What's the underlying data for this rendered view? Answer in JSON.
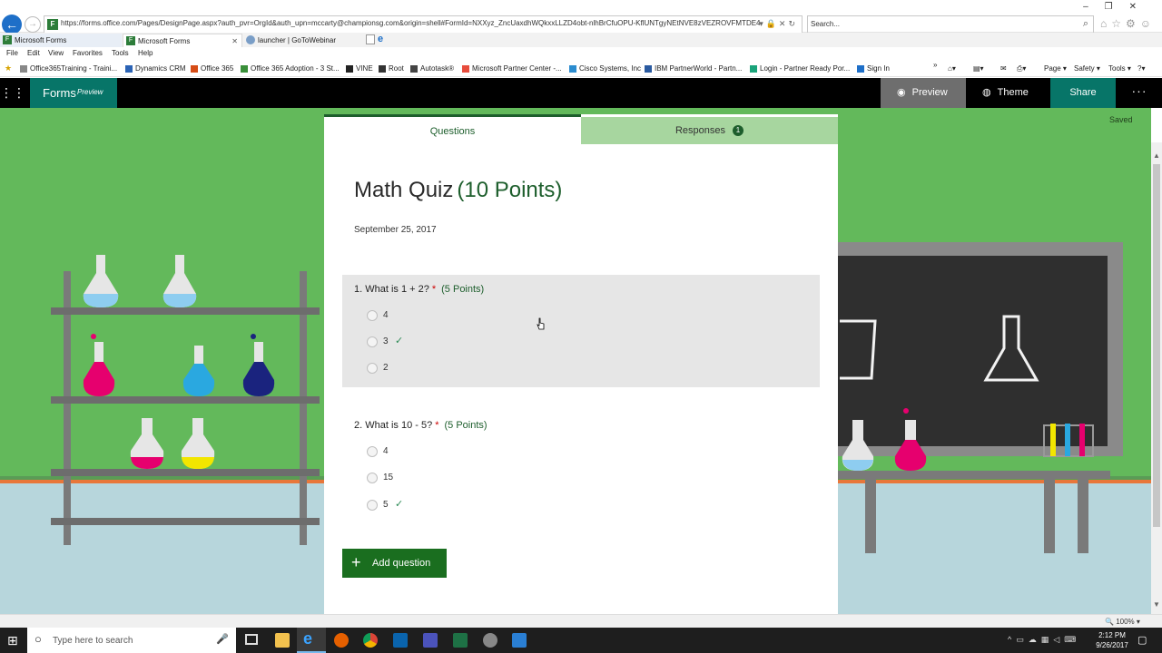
{
  "browser": {
    "url": "https://forms.office.com/Pages/DesignPage.aspx?auth_pvr=OrgId&auth_upn=mccarty@championsg.com&origin=shell#FormId=NXXyz_ZncUaxdhWQkxxLLZD4obt-nlhBrCfuOPU-KflUNTgyNEtNVE8zVEZROVFMTDE4TFBM",
    "search_placeholder": "Search...",
    "tabs": [
      {
        "label": "Microsoft Forms"
      },
      {
        "label": "Microsoft Forms"
      },
      {
        "label": "launcher | GoToWebinar"
      }
    ],
    "menu": [
      "File",
      "Edit",
      "View",
      "Favorites",
      "Tools",
      "Help"
    ],
    "favorites": [
      {
        "label": "Office365Training - Traini...",
        "color": "#c7a93a"
      },
      {
        "label": "Dynamics CRM",
        "color": "#2b63b5"
      },
      {
        "label": "Office 365",
        "color": "#d64c16"
      },
      {
        "label": "Office 365 Adoption - 3 St...",
        "color": "#3a8f3a"
      },
      {
        "label": "VINE",
        "color": "#222222"
      },
      {
        "label": "Root",
        "color": "#333333"
      },
      {
        "label": "Autotask®",
        "color": "#444444"
      },
      {
        "label": "Microsoft Partner Center -...",
        "color": "#e74c3c"
      },
      {
        "label": "Cisco Systems, Inc",
        "color": "#2b8ccf"
      },
      {
        "label": "IBM PartnerWorld - Partn...",
        "color": "#2a5aa0"
      },
      {
        "label": "Login - Partner Ready Por...",
        "color": "#1aa37a"
      },
      {
        "label": "Sign In",
        "color": "#1e6fc8"
      }
    ],
    "commands": [
      "Page ▾",
      "Safety ▾",
      "Tools ▾"
    ],
    "zoom": "100%"
  },
  "appbar": {
    "brand": "Forms",
    "brand_suffix": "Preview",
    "preview_label": "Preview",
    "theme_label": "Theme",
    "share_label": "Share",
    "more_label": "···"
  },
  "status": {
    "saved": "Saved"
  },
  "form": {
    "tabs": {
      "questions": "Questions",
      "responses": "Responses",
      "responses_count": "1"
    },
    "title": "Math Quiz",
    "title_points": "(10 Points)",
    "date": "September 25, 2017",
    "questions": [
      {
        "text": "1. What is 1 + 2?",
        "required": "*",
        "points": "(5 Points)",
        "options": [
          {
            "label": "4",
            "correct": false
          },
          {
            "label": "3",
            "correct": true
          },
          {
            "label": "2",
            "correct": false
          }
        ]
      },
      {
        "text": "2. What is 10 - 5?",
        "required": "*",
        "points": "(5 Points)",
        "options": [
          {
            "label": "4",
            "correct": false
          },
          {
            "label": "15",
            "correct": false
          },
          {
            "label": "5",
            "correct": true
          }
        ]
      }
    ],
    "add_question_label": "Add question"
  },
  "taskbar": {
    "search_placeholder": "Type here to search",
    "time": "2:12 PM",
    "date": "9/26/2017"
  }
}
